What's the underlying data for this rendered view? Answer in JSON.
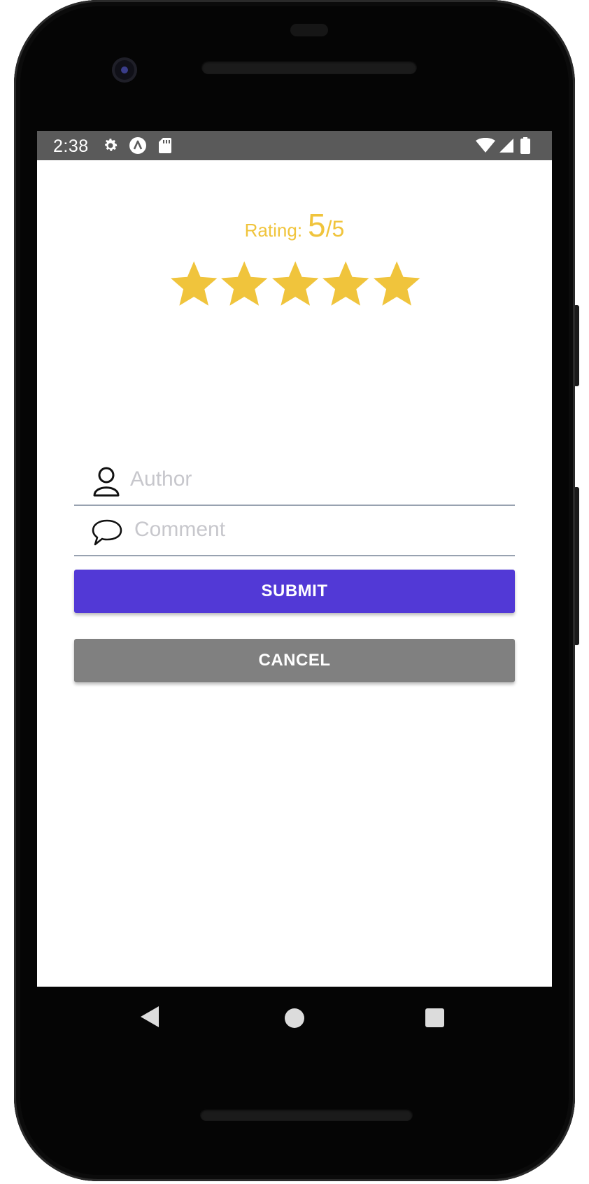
{
  "status_bar": {
    "time": "2:38",
    "left_icons": [
      "settings-icon",
      "app-notification-icon",
      "sd-card-icon"
    ],
    "right_icons": [
      "wifi-icon",
      "cellular-signal-icon",
      "battery-icon"
    ]
  },
  "rating": {
    "label": "Rating:",
    "value": "5",
    "separator": "/",
    "max": "5",
    "stars_filled": 5,
    "stars_total": 5,
    "star_color": "#f0c43c"
  },
  "form": {
    "author": {
      "placeholder": "Author",
      "value": "",
      "icon": "user-icon"
    },
    "comment": {
      "placeholder": "Comment",
      "value": "",
      "icon": "speech-bubble-icon"
    }
  },
  "buttons": {
    "submit": {
      "label": "SUBMIT",
      "color": "#5239d6"
    },
    "cancel": {
      "label": "CANCEL",
      "color": "#808080"
    }
  },
  "navigation": [
    "back-icon",
    "home-icon",
    "recents-icon"
  ]
}
